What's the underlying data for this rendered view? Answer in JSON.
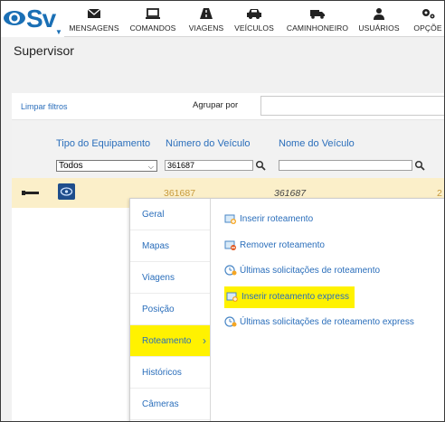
{
  "app": {
    "logo_text": "Sv",
    "nav": [
      {
        "label": "MENSAGENS",
        "icon": "mail-icon"
      },
      {
        "label": "COMANDOS",
        "icon": "laptop-icon"
      },
      {
        "label": "VIAGENS",
        "icon": "road-icon"
      },
      {
        "label": "VEÍCULOS",
        "icon": "car-icon"
      },
      {
        "label": "CAMINHONEIRO",
        "icon": "truck-icon"
      },
      {
        "label": "USUÁRIOS",
        "icon": "user-icon"
      },
      {
        "label": "OPÇÕE",
        "icon": "gear-icon"
      }
    ]
  },
  "page": {
    "title": "Supervisor"
  },
  "filters": {
    "clear_label": "Limpar filtros",
    "group_by_label": "Agrupar por",
    "group_by_value": ""
  },
  "table": {
    "columns": [
      "Tipo do Equipamento",
      "Número do Veículo",
      "Nome do Veículo"
    ],
    "type_filter_value": "Todos",
    "vehicle_number_filter": "361687",
    "vehicle_name_filter": "",
    "row": {
      "vehicle_number": "361687",
      "vehicle_name": "361687",
      "truncated": "2"
    }
  },
  "menu": {
    "left_items": [
      "Geral",
      "Mapas",
      "Viagens",
      "Posição",
      "Roteamento",
      "Históricos",
      "Câmeras"
    ],
    "active_item": "Roteamento",
    "sub_items": [
      "Inserir roteamento",
      "Remover roteamento",
      "Últimas solicitações de roteamento",
      "Inserir roteamento express",
      "Últimas solicitações de roteamento express"
    ]
  },
  "colors": {
    "accent": "#2a6ebb",
    "highlight": "#fff200",
    "row_bg": "#fbefc9",
    "logo": "#1a6fb5"
  }
}
